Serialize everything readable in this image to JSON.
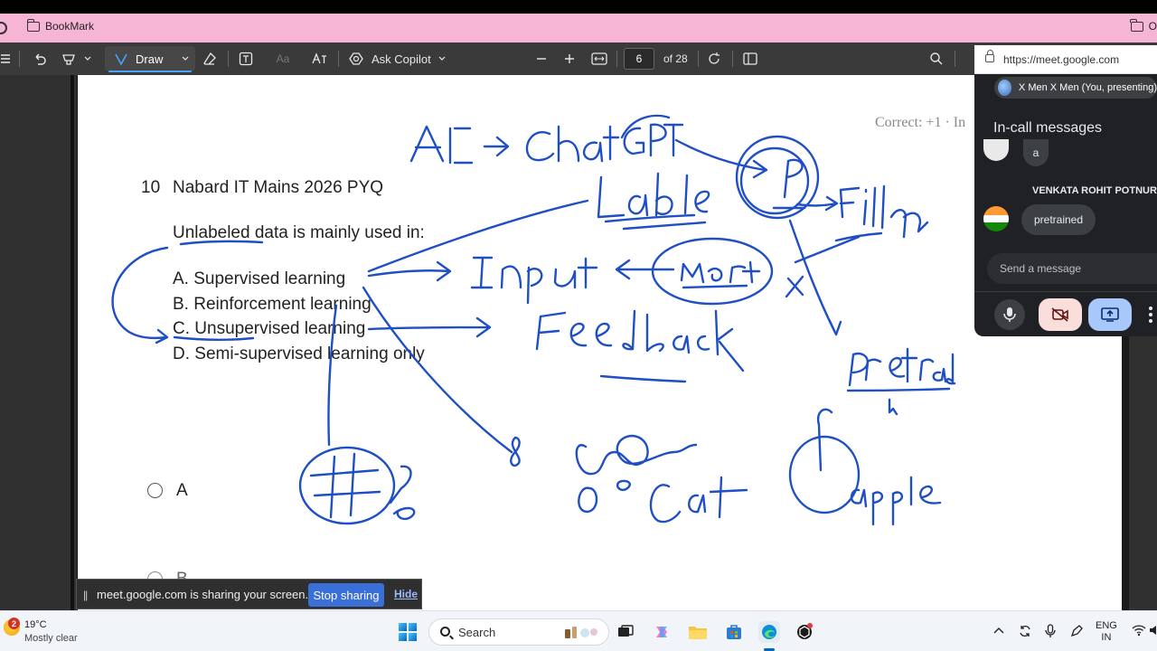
{
  "bookmark_bar": {
    "folder_label": "BookMark",
    "right_folder_label": "O"
  },
  "pdf_toolbar": {
    "draw_label": "Draw",
    "copilot_label": "Ask Copilot",
    "current_page": "6",
    "total_pages_label": "of 28",
    "font_glyph": "Aa"
  },
  "document": {
    "question_number": "10",
    "question_title": "Nabard IT Mains 2026 PYQ",
    "question_prompt": "Unlabeled data is mainly used in:",
    "options": [
      "A. Supervised learning",
      "B. Reinforcement learning",
      "C. Unsupervised learning",
      "D. Semi-supervised learning only"
    ],
    "scoring_text": "Correct: +1 · In",
    "answer_choice_a": "A",
    "answer_choice_b": "B"
  },
  "share_banner": {
    "pause_glyph": "||",
    "message": "meet.google.com is sharing your screen.",
    "stop_label": "Stop sharing",
    "hide_label": "Hide"
  },
  "meet": {
    "url": "https://meet.google.com",
    "presenter_label": "X Men X Men (You, presenting)",
    "panel_title": "In-call messages",
    "messages": [
      {
        "sender": "",
        "text": "a"
      },
      {
        "sender": "VENKATA ROHIT POTNUR",
        "text": "pretrained"
      }
    ],
    "send_placeholder": "Send a message"
  },
  "taskbar": {
    "notification_count": "2",
    "weather_temp": "19°C",
    "weather_desc": "Mostly clear",
    "search_label": "Search",
    "language_line1": "ENG",
    "language_line2": "IN"
  },
  "colors": {
    "ink": "#1f4fc4",
    "bookmark_bar": "#f7b5d6",
    "stop_sharing": "#3a6fd8",
    "meet_panel": "#202124"
  }
}
